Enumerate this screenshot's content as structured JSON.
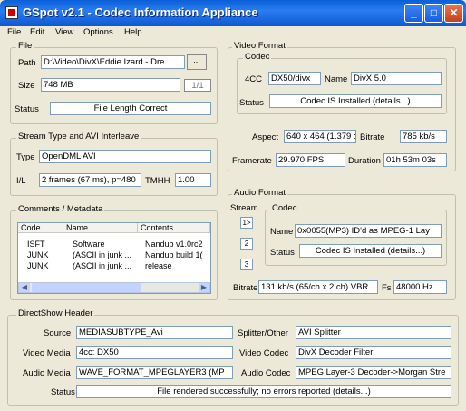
{
  "window": {
    "title": "GSpot v2.1 - Codec Information Appliance",
    "minimize": "_",
    "maximize": "□",
    "close": "✕"
  },
  "menu": [
    "File",
    "Edit",
    "View",
    "Options",
    "Help"
  ],
  "file": {
    "group_title": "File",
    "path_label": "Path",
    "path_value": "D:\\Video\\DivX\\Eddie Izard - Dre",
    "browse_label": "...",
    "size_label": "Size",
    "size_value": "748 MB",
    "page_counter": "1/1",
    "status_label": "Status",
    "status_value": "File Length Correct"
  },
  "stream_type": {
    "group_title": "Stream Type and AVI Interleave",
    "type_label": "Type",
    "type_value": "OpenDML AVI",
    "il_label": "I/L",
    "il_value": "2 frames (67 ms), p=480",
    "tmhh_label": "TMHH",
    "tmhh_value": "1.00"
  },
  "comments": {
    "group_title": "Comments / Metadata",
    "columns": [
      "Code",
      "Name",
      "Contents"
    ],
    "rows": [
      [
        "ISFT",
        "Software",
        "Nandub v1.0rc2"
      ],
      [
        "JUNK",
        "(ASCII in junk ...",
        "Nandub build 1("
      ],
      [
        "JUNK",
        "(ASCII in junk ...",
        "release"
      ]
    ]
  },
  "video_format": {
    "group_title": "Video Format",
    "codec_title": "Codec",
    "fourcc_label": "4CC",
    "fourcc_value": "DX50/divx",
    "name_label": "Name",
    "name_value": "DivX 5.0",
    "status_label": "Status",
    "status_value": "Codec IS Installed   (details...)",
    "aspect_label": "Aspect",
    "aspect_value": "640 x 464  (1.379 :",
    "bitrate_label": "Bitrate",
    "bitrate_value": "785 kb/s",
    "framerate_label": "Framerate",
    "framerate_value": "29.970 FPS",
    "duration_label": "Duration",
    "duration_value": "01h 53m 03s"
  },
  "audio_format": {
    "group_title": "Audio Format",
    "stream_label": "Stream",
    "stream_buttons": [
      "1>",
      "2",
      "3"
    ],
    "codec_title": "Codec",
    "name_label": "Name",
    "name_value": "0x0055(MP3) ID'd as MPEG-1 Lay",
    "status_label": "Status",
    "status_value": "Codec IS Installed   (details...)",
    "bitrate_label": "Bitrate",
    "bitrate_value": "131 kb/s (65/ch x 2 ch) VBR",
    "fs_label": "Fs",
    "fs_value": "48000 Hz"
  },
  "directshow": {
    "group_title": "DirectShow Header",
    "source_label": "Source",
    "source_value": "MEDIASUBTYPE_Avi",
    "splitter_label": "Splitter/Other",
    "splitter_value": "AVI Splitter",
    "video_media_label": "Video Media",
    "video_media_value": "4cc: DX50",
    "video_codec_label": "Video Codec",
    "video_codec_value": "DivX Decoder Filter",
    "audio_media_label": "Audio Media",
    "audio_media_value": "WAVE_FORMAT_MPEGLAYER3 (MP",
    "audio_codec_label": "Audio Codec",
    "audio_codec_value": "MPEG Layer-3 Decoder->Morgan Stre",
    "status_label": "Status",
    "status_value": "File rendered successfully; no errors reported    (details...)"
  }
}
